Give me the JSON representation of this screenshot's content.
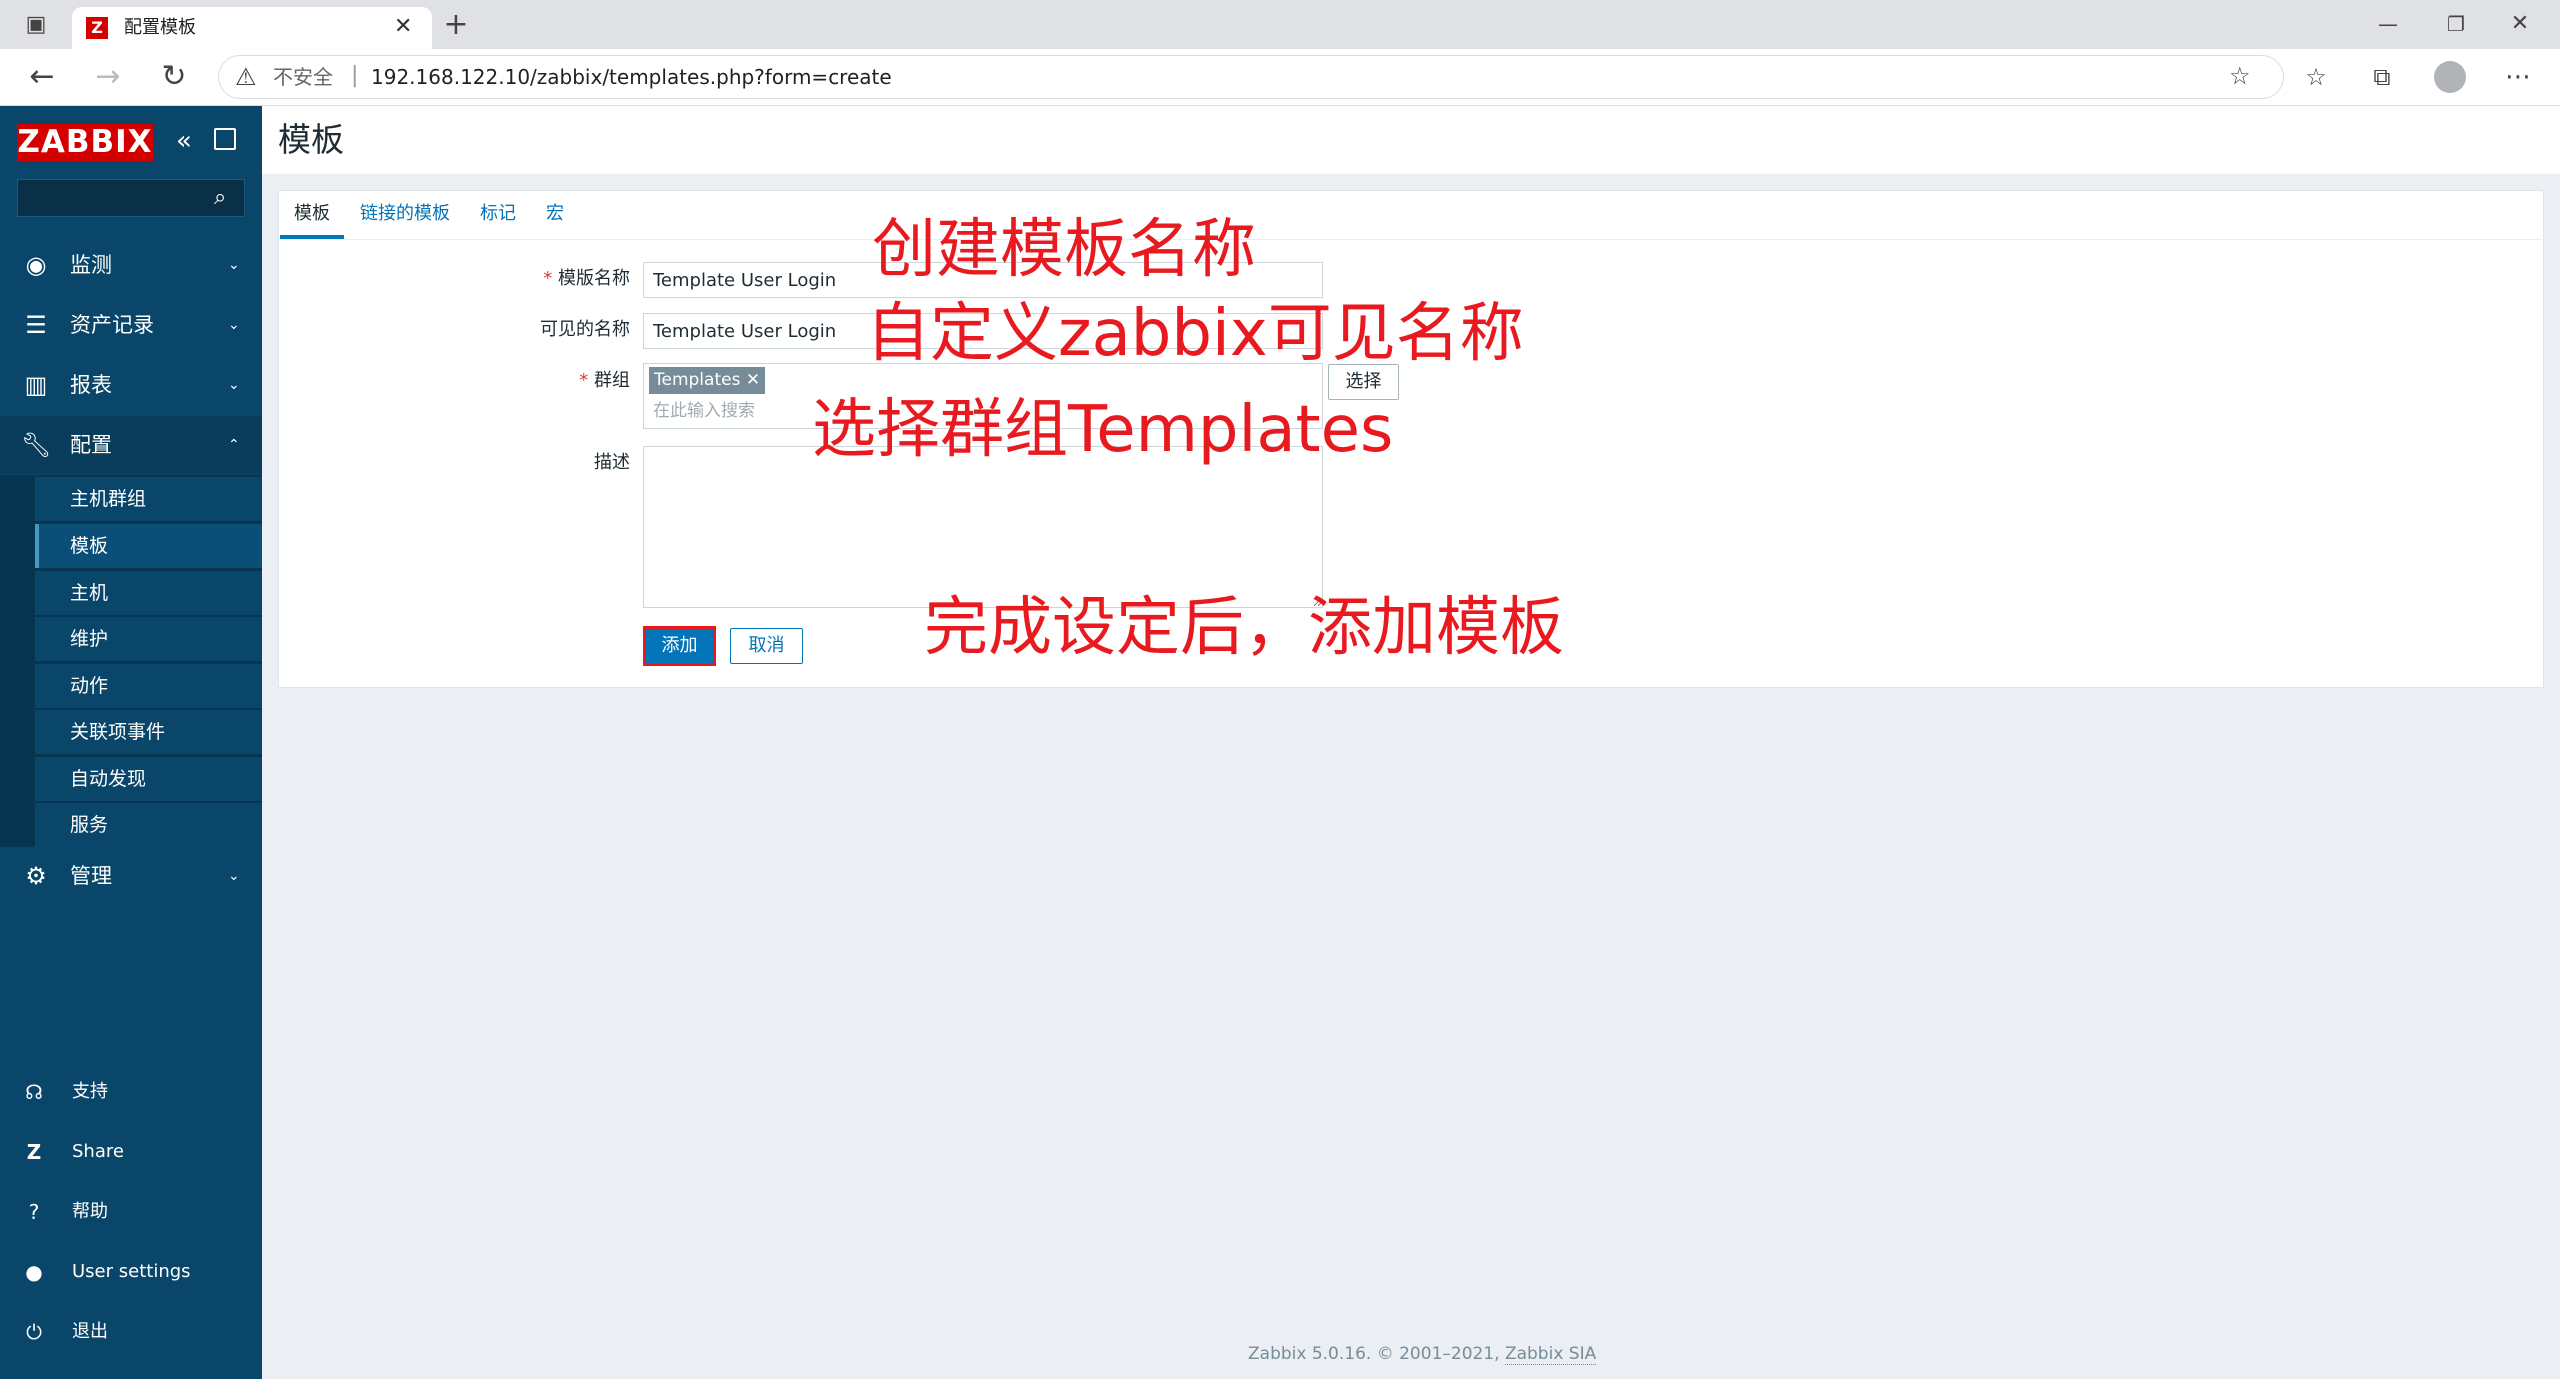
{
  "browser": {
    "tab_title": "配置模板",
    "security_label": "不安全",
    "url": "192.168.122.10/zabbix/templates.php?form=create"
  },
  "sidebar": {
    "logo": "ZABBIX",
    "items": [
      {
        "label": "监测"
      },
      {
        "label": "资产记录"
      },
      {
        "label": "报表"
      },
      {
        "label": "配置"
      },
      {
        "label": "管理"
      }
    ],
    "config_sub": [
      "主机群组",
      "模板",
      "主机",
      "维护",
      "动作",
      "关联项事件",
      "自动发现",
      "服务"
    ],
    "bottom": [
      "支持",
      "Share",
      "帮助",
      "User settings",
      "退出"
    ]
  },
  "page": {
    "title": "模板",
    "tabs": [
      "模板",
      "链接的模板",
      "标记",
      "宏"
    ]
  },
  "form": {
    "template_name_label": "模版名称",
    "template_name_value": "Template User Login",
    "visible_name_label": "可见的名称",
    "visible_name_value": "Template User Login",
    "groups_label": "群组",
    "group_chip": "Templates",
    "group_placeholder": "在此输入搜索",
    "select_button": "选择",
    "description_label": "描述",
    "add_button": "添加",
    "cancel_button": "取消"
  },
  "annotations": [
    "创建模板名称",
    "自定义zabbix可见名称",
    "选择群组Templates",
    "完成设定后，添加模板"
  ],
  "footer": {
    "text": "Zabbix 5.0.16. © 2001–2021, ",
    "link": "Zabbix SIA"
  },
  "colors": {
    "sidebar": "#0a466a",
    "logo": "#d40000",
    "accent": "#0275b8",
    "annotation": "#e8191f"
  }
}
